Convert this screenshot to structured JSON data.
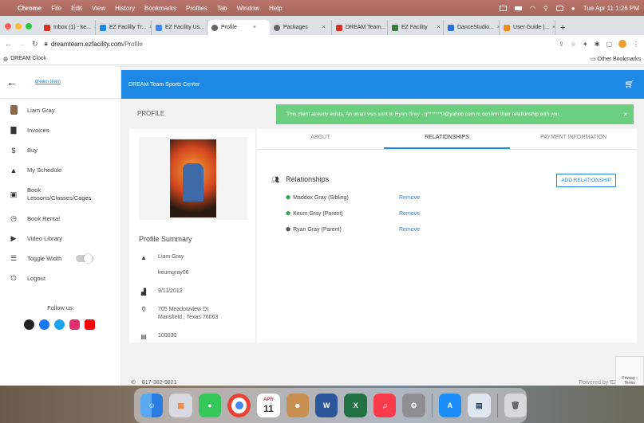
{
  "menubar": {
    "items": [
      "Chrome",
      "File",
      "Edit",
      "View",
      "History",
      "Bookmarks",
      "Profiles",
      "Tab",
      "Window",
      "Help"
    ],
    "clock": "Tue Apr 11 1:26 PM"
  },
  "browser": {
    "tabs": [
      {
        "label": "Inbox (1) - ke...",
        "color": "#d93025"
      },
      {
        "label": "EZ Facility Tr...",
        "color": "#1e88e5"
      },
      {
        "label": "EZ Facility Us...",
        "color": "#4285f4"
      },
      {
        "label": "Profile",
        "color": "#555555"
      },
      {
        "label": "Packages",
        "color": "#555555"
      },
      {
        "label": "DREAM Team...",
        "color": "#d93025"
      },
      {
        "label": "EZ Facility",
        "color": "#3b7a3b"
      },
      {
        "label": "DanceStudio...",
        "color": "#2a6fd6"
      },
      {
        "label": "User Guide |...",
        "color": "#f08c1c"
      }
    ],
    "active_tab_index": 3,
    "url_domain": "dreamteam.ezfacility.com",
    "url_path": "/Profile",
    "bookmark": "DREAM Clock",
    "other_bookmarks": "Other Bookmarks"
  },
  "sidebar": {
    "logo": "dream team",
    "items": [
      {
        "label": "Liam Gray",
        "icon": "user-avatar"
      },
      {
        "label": "Invoices",
        "icon": "document-icon"
      },
      {
        "label": "Buy",
        "icon": "dollar-icon"
      },
      {
        "label": "My Schedule",
        "icon": "person-icon"
      },
      {
        "label": "Book Lessons/Classes/Cages",
        "icon": "calendar-icon"
      },
      {
        "label": "Book Rental",
        "icon": "timer-icon"
      },
      {
        "label": "Video Library",
        "icon": "video-icon"
      },
      {
        "label": "Toggle Width",
        "icon": "width-icon"
      },
      {
        "label": "Logout",
        "icon": "power-icon"
      }
    ],
    "follow_label": "Follow us:",
    "social": [
      {
        "name": "social-other",
        "color": "#222222"
      },
      {
        "name": "facebook",
        "color": "#1877f2"
      },
      {
        "name": "twitter",
        "color": "#1da1f2"
      },
      {
        "name": "instagram",
        "color": "#e1306c"
      },
      {
        "name": "youtube",
        "color": "#ff0000"
      }
    ]
  },
  "header": {
    "title": "DREAM Team Sports Center"
  },
  "page": {
    "label": "PROFILE",
    "alert": "This client already exists. An email was sent to Ryan Gray - g*******0@yahoo.com to confirm their relationship with you.",
    "tabs": [
      "ABOUT",
      "RELATIONSHIPS",
      "PAYMENT INFORMATION"
    ],
    "active_tab": 1
  },
  "profile_summary": {
    "title": "Profile Summary",
    "name": "Liam Gray",
    "username": "keumgray06",
    "dob": "9/11/2012",
    "address_line1": "705 Meadowview Dr.",
    "address_line2": "Mansfield , Texas 76063",
    "member_id": "100030"
  },
  "relationships": {
    "heading": "Relationships",
    "add_button": "ADD RELATIONSHIP",
    "remove_label": "Remove",
    "items": [
      {
        "name": "Maddox Gray (Sibling)",
        "verified": true
      },
      {
        "name": "Keum Gray (Parent)",
        "verified": true
      },
      {
        "name": "Ryan Gray (Parent)",
        "verified": false
      }
    ]
  },
  "footer": {
    "phone": "817-382-9821",
    "powered": "Powered by EZFacility"
  },
  "dock": {
    "calendar_month": "APR",
    "calendar_day": "11"
  }
}
